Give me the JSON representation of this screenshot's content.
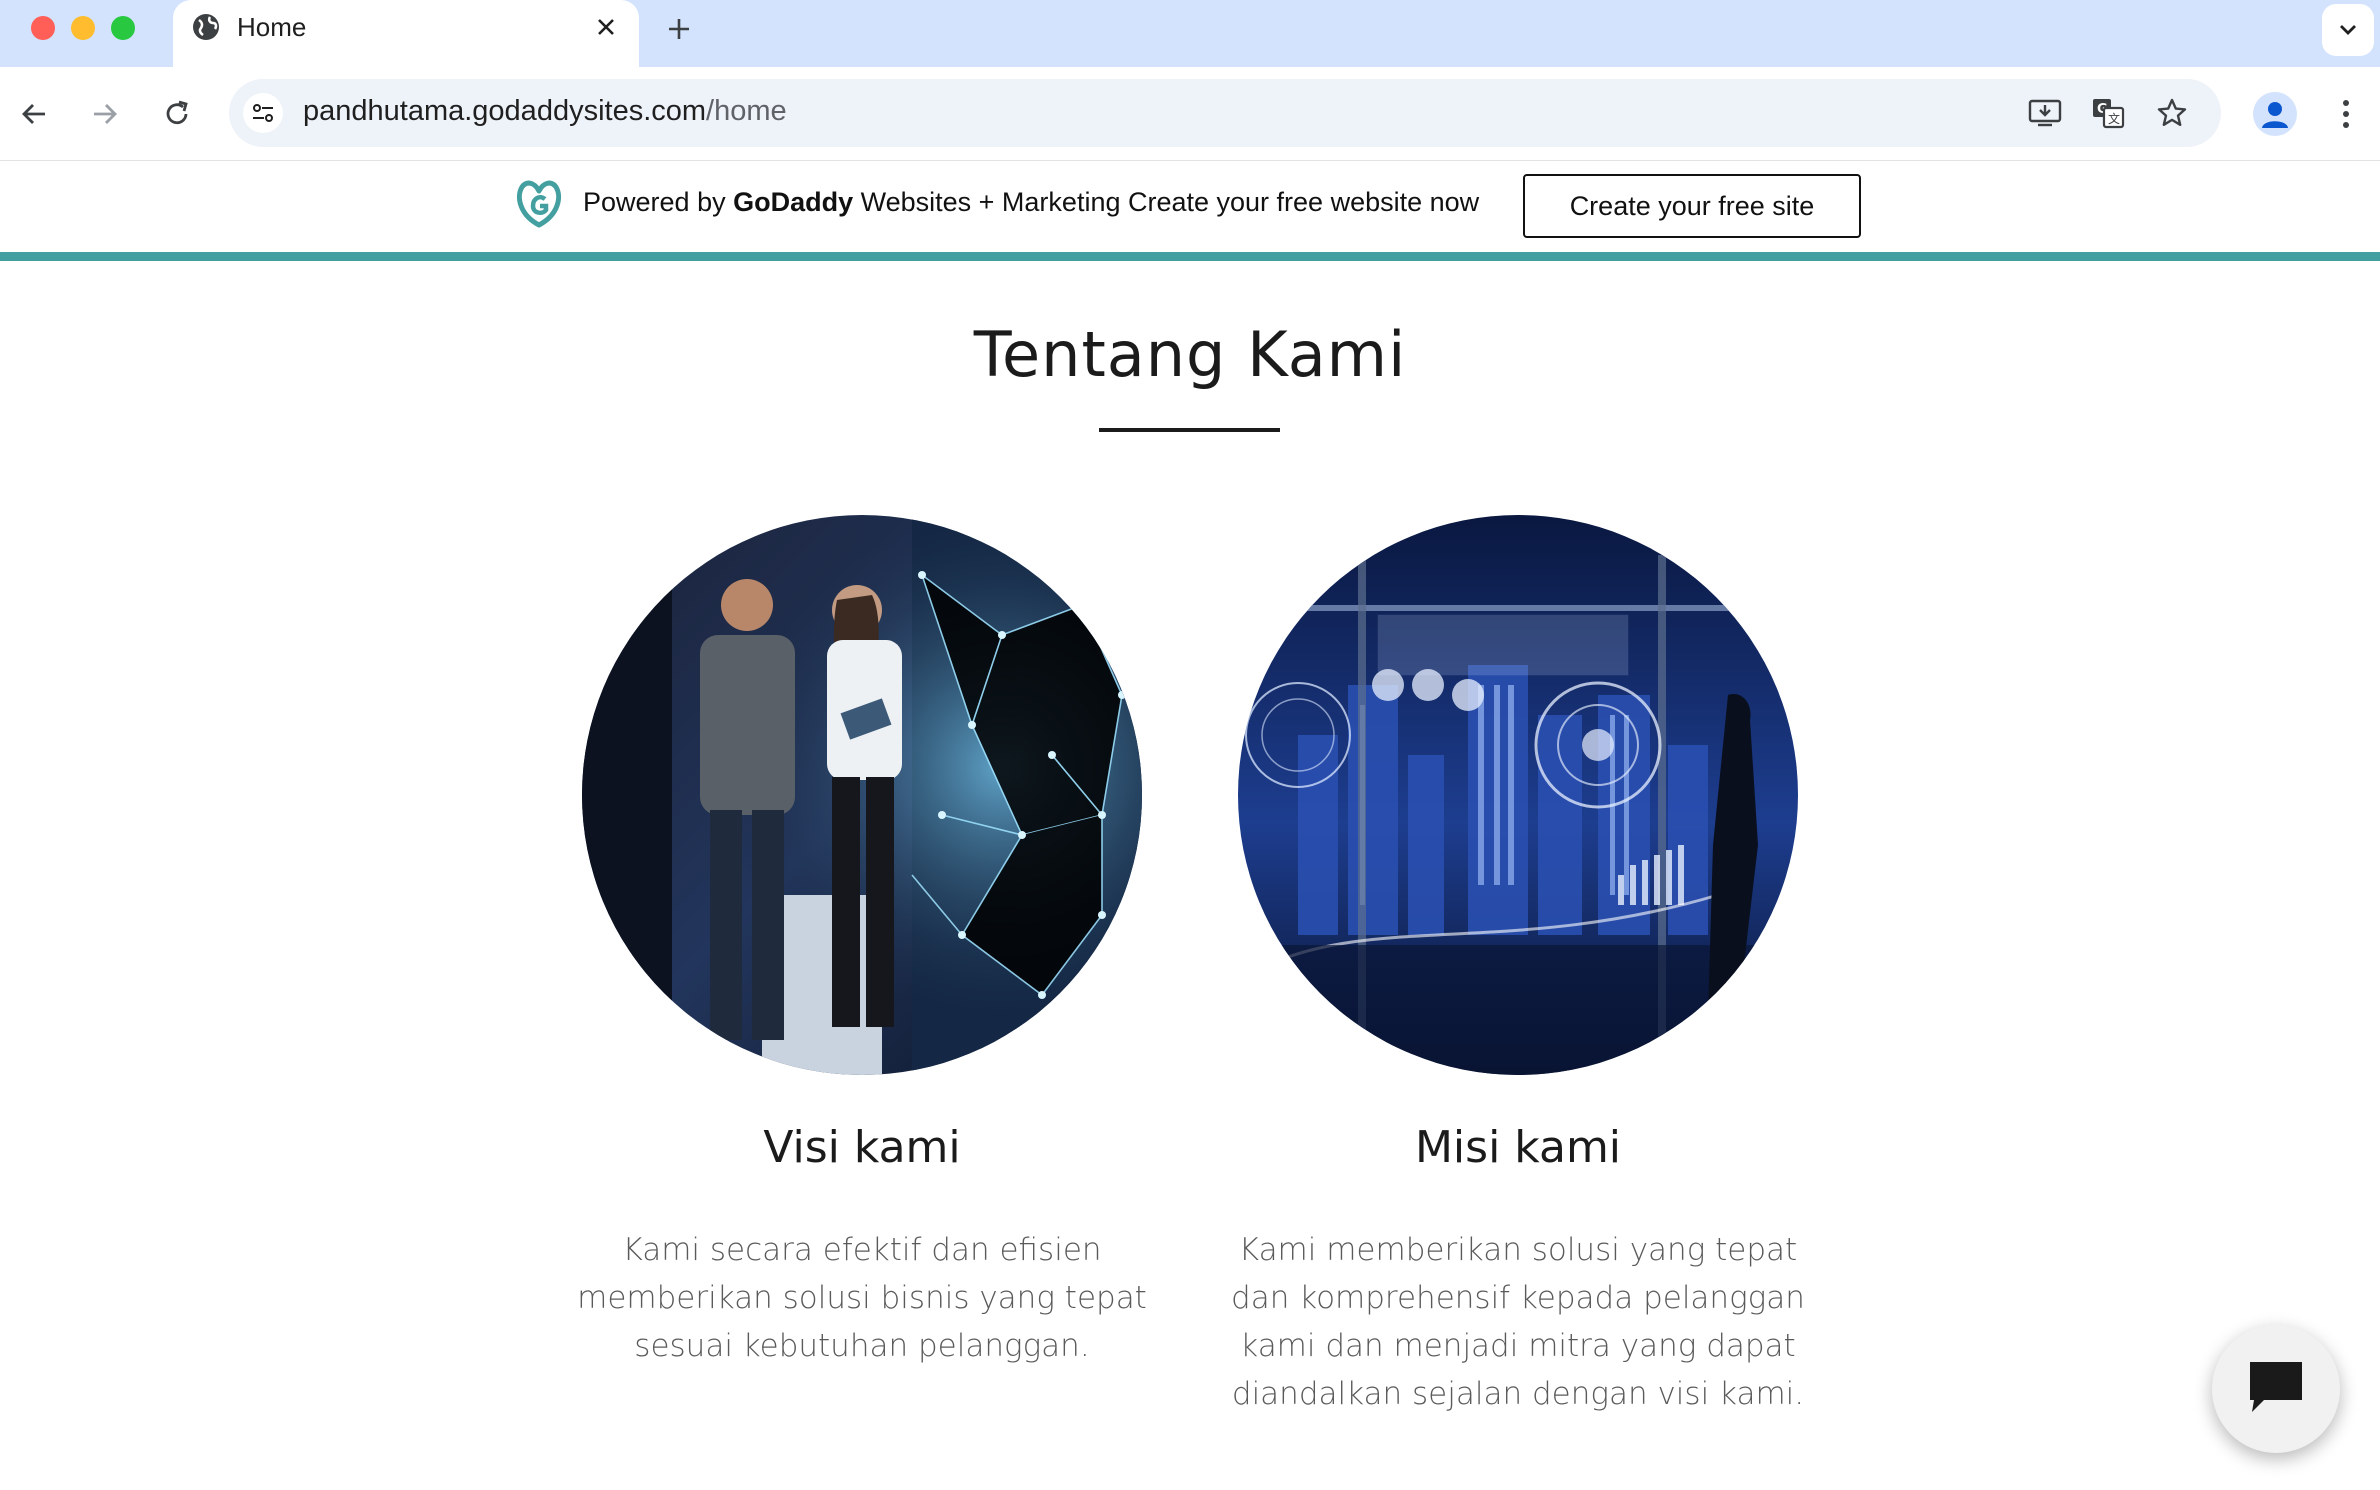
{
  "browser": {
    "tab_title": "Home",
    "url_domain": "pandhutama.godaddysites.com",
    "url_path": "/home",
    "icons": [
      "globe-icon",
      "close-icon",
      "plus-icon",
      "chevron-down-icon",
      "back-arrow-icon",
      "forward-arrow-icon",
      "reload-icon",
      "site-settings-icon",
      "install-app-icon",
      "translate-icon",
      "bookmark-star-icon",
      "profile-icon",
      "more-vert-icon"
    ]
  },
  "banner": {
    "powered_prefix": "Powered by ",
    "brand": "GoDaddy",
    "powered_suffix": " Websites + Marketing Create your free website now",
    "button_label": "Create your free site",
    "accent_color": "#44a0a0"
  },
  "section": {
    "title": "Tentang Kami",
    "cards": [
      {
        "title": "Visi kami",
        "text": "Kami secara efektif dan efisien memberikan solusi bisnis yang tepat sesuai kebutuhan pelanggan."
      },
      {
        "title": "Misi kami",
        "text": "Kami memberikan solusi yang tepat dan komprehensif kepada pelanggan kami dan menjadi mitra yang dapat diandalkan sejalan dengan visi kami."
      }
    ]
  },
  "chat": {
    "icon": "chat-bubble-icon"
  }
}
